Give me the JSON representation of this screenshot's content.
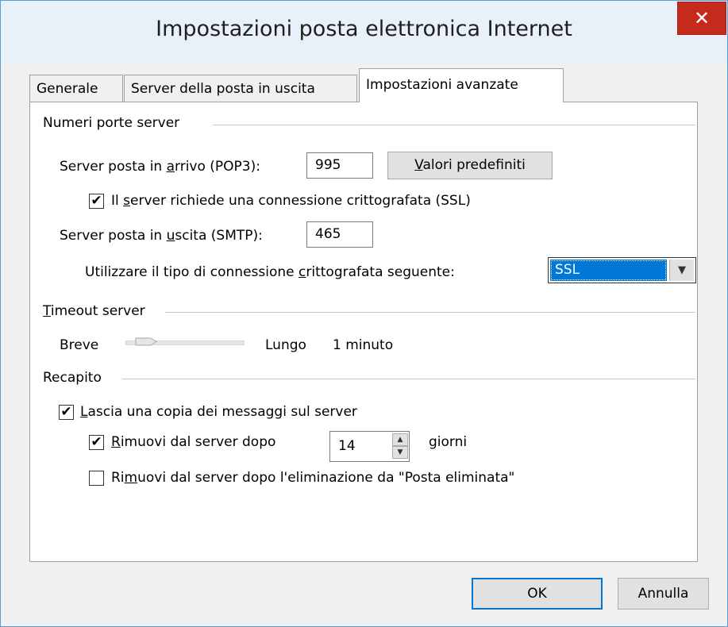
{
  "window": {
    "title": "Impostazioni posta elettronica Internet",
    "close_label": "✕"
  },
  "tabs": [
    {
      "label": "Generale",
      "active": false
    },
    {
      "label": "Server della posta in uscita",
      "active": false
    },
    {
      "label": "Impostazioni avanzate",
      "active": true
    }
  ],
  "ports": {
    "group_label": "Numeri porte server",
    "incoming_label_pre": "Server posta in ",
    "incoming_label_u": "a",
    "incoming_label_post": "rrivo (POP3):",
    "incoming_value": "995",
    "defaults_button_u": "V",
    "defaults_button_post": "alori predefiniti",
    "ssl_check_pre": "Il ",
    "ssl_check_u": "s",
    "ssl_check_post": "erver richiede una connessione crittografata (SSL)",
    "ssl_checked": true,
    "outgoing_label_pre": "Server posta in ",
    "outgoing_label_u": "u",
    "outgoing_label_post": "scita (SMTP):",
    "outgoing_value": "465",
    "encryption_label_pre": "Utilizzare il tipo di connessione ",
    "encryption_label_u": "c",
    "encryption_label_post": "rittografata seguente:",
    "encryption_value": "SSL"
  },
  "timeout": {
    "group_label_u": "T",
    "group_label_post": "imeout server",
    "short_label": "Breve",
    "long_label": "Lungo",
    "value_label": "1 minuto",
    "level": 0.1
  },
  "delivery": {
    "group_label": "Recapito",
    "leave_copy_u": "L",
    "leave_copy_post": "ascia una copia dei messaggi sul server",
    "leave_copy_checked": true,
    "remove_after_u": "R",
    "remove_after_post": "imuovi dal server dopo",
    "remove_after_checked": true,
    "days_value": "14",
    "days_label": "giorni",
    "remove_deleted_pre": "Ri",
    "remove_deleted_u": "m",
    "remove_deleted_post": "uovi dal server dopo l'eliminazione da \"Posta eliminata\"",
    "remove_deleted_checked": false
  },
  "footer": {
    "ok_label": "OK",
    "cancel_label": "Annulla"
  },
  "icons": {
    "check": "✔",
    "chevron_down": "▼",
    "spin_up": "▲",
    "spin_down": "▼"
  }
}
